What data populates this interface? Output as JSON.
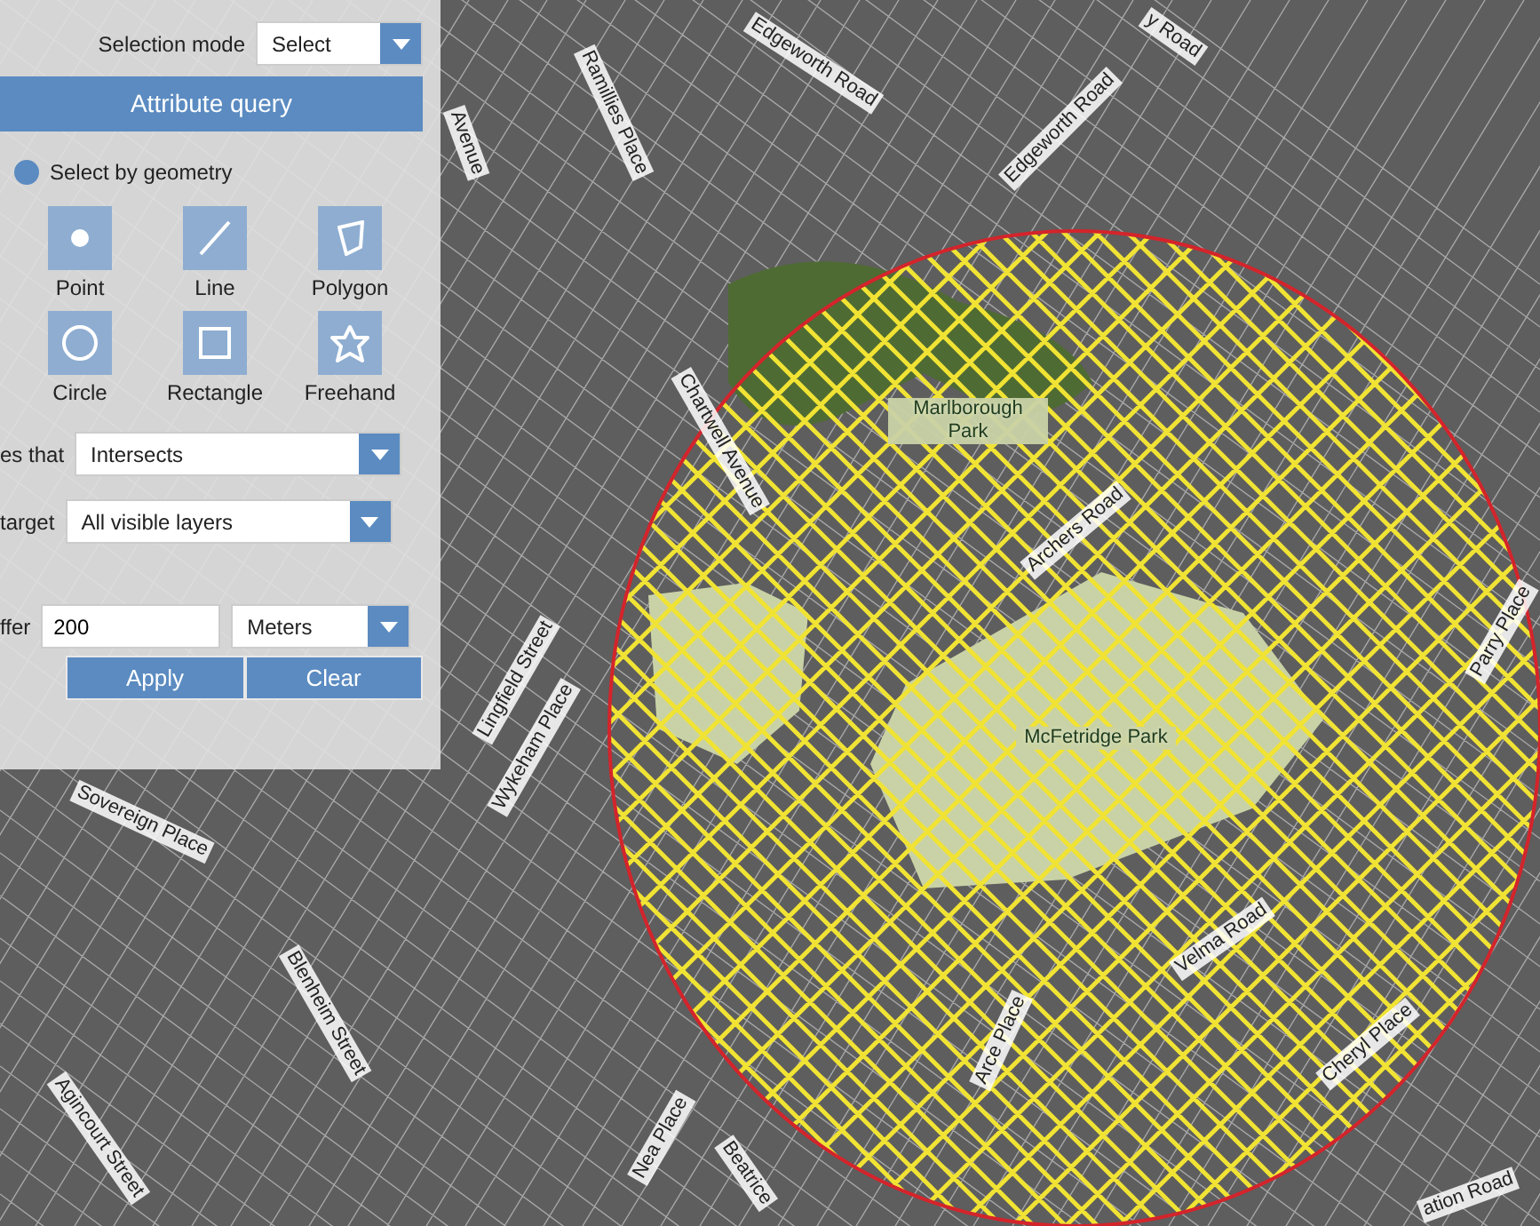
{
  "panel": {
    "selection_mode": {
      "label": "Selection mode",
      "value": "Select"
    },
    "attribute_query": "Attribute query",
    "select_by_geometry": {
      "label": "Select by geometry",
      "selected": true
    },
    "tools": [
      {
        "kind": "point",
        "label": "Point"
      },
      {
        "kind": "line",
        "label": "Line"
      },
      {
        "kind": "polygon",
        "label": "Polygon"
      },
      {
        "kind": "circle",
        "label": "Circle"
      },
      {
        "kind": "rectangle",
        "label": "Rectangle"
      },
      {
        "kind": "freehand",
        "label": "Freehand"
      }
    ],
    "relation": {
      "label": "es that",
      "value": "Intersects"
    },
    "target": {
      "label": "target",
      "value": "All visible layers"
    },
    "buffer": {
      "label": "ffer",
      "value": "200",
      "unit": "Meters"
    },
    "buttons": [
      "Apply",
      "Clear"
    ]
  },
  "map": {
    "labels": [
      {
        "text": "Edgeworth Road"
      },
      {
        "text": "y Road"
      },
      {
        "text": "Ramillies Place"
      },
      {
        "text": "Avenue"
      },
      {
        "text": "Edgeworth Road"
      },
      {
        "text": "Chartwell Avenue"
      },
      {
        "text": "Marlborough Park"
      },
      {
        "text": "Archers Road"
      },
      {
        "text": "McFetridge Park"
      },
      {
        "text": "Parry Place"
      },
      {
        "text": "Lingfield Street"
      },
      {
        "text": "Wykeham Place"
      },
      {
        "text": "Sovereign Place"
      },
      {
        "text": "Blenheim Street"
      },
      {
        "text": "Agincourt Street"
      },
      {
        "text": "Nea Place"
      },
      {
        "text": "Beatrice"
      },
      {
        "text": "Velma Road"
      },
      {
        "text": "Arce Place"
      },
      {
        "text": "Cheryl Place"
      },
      {
        "text": "ation Road"
      }
    ]
  }
}
